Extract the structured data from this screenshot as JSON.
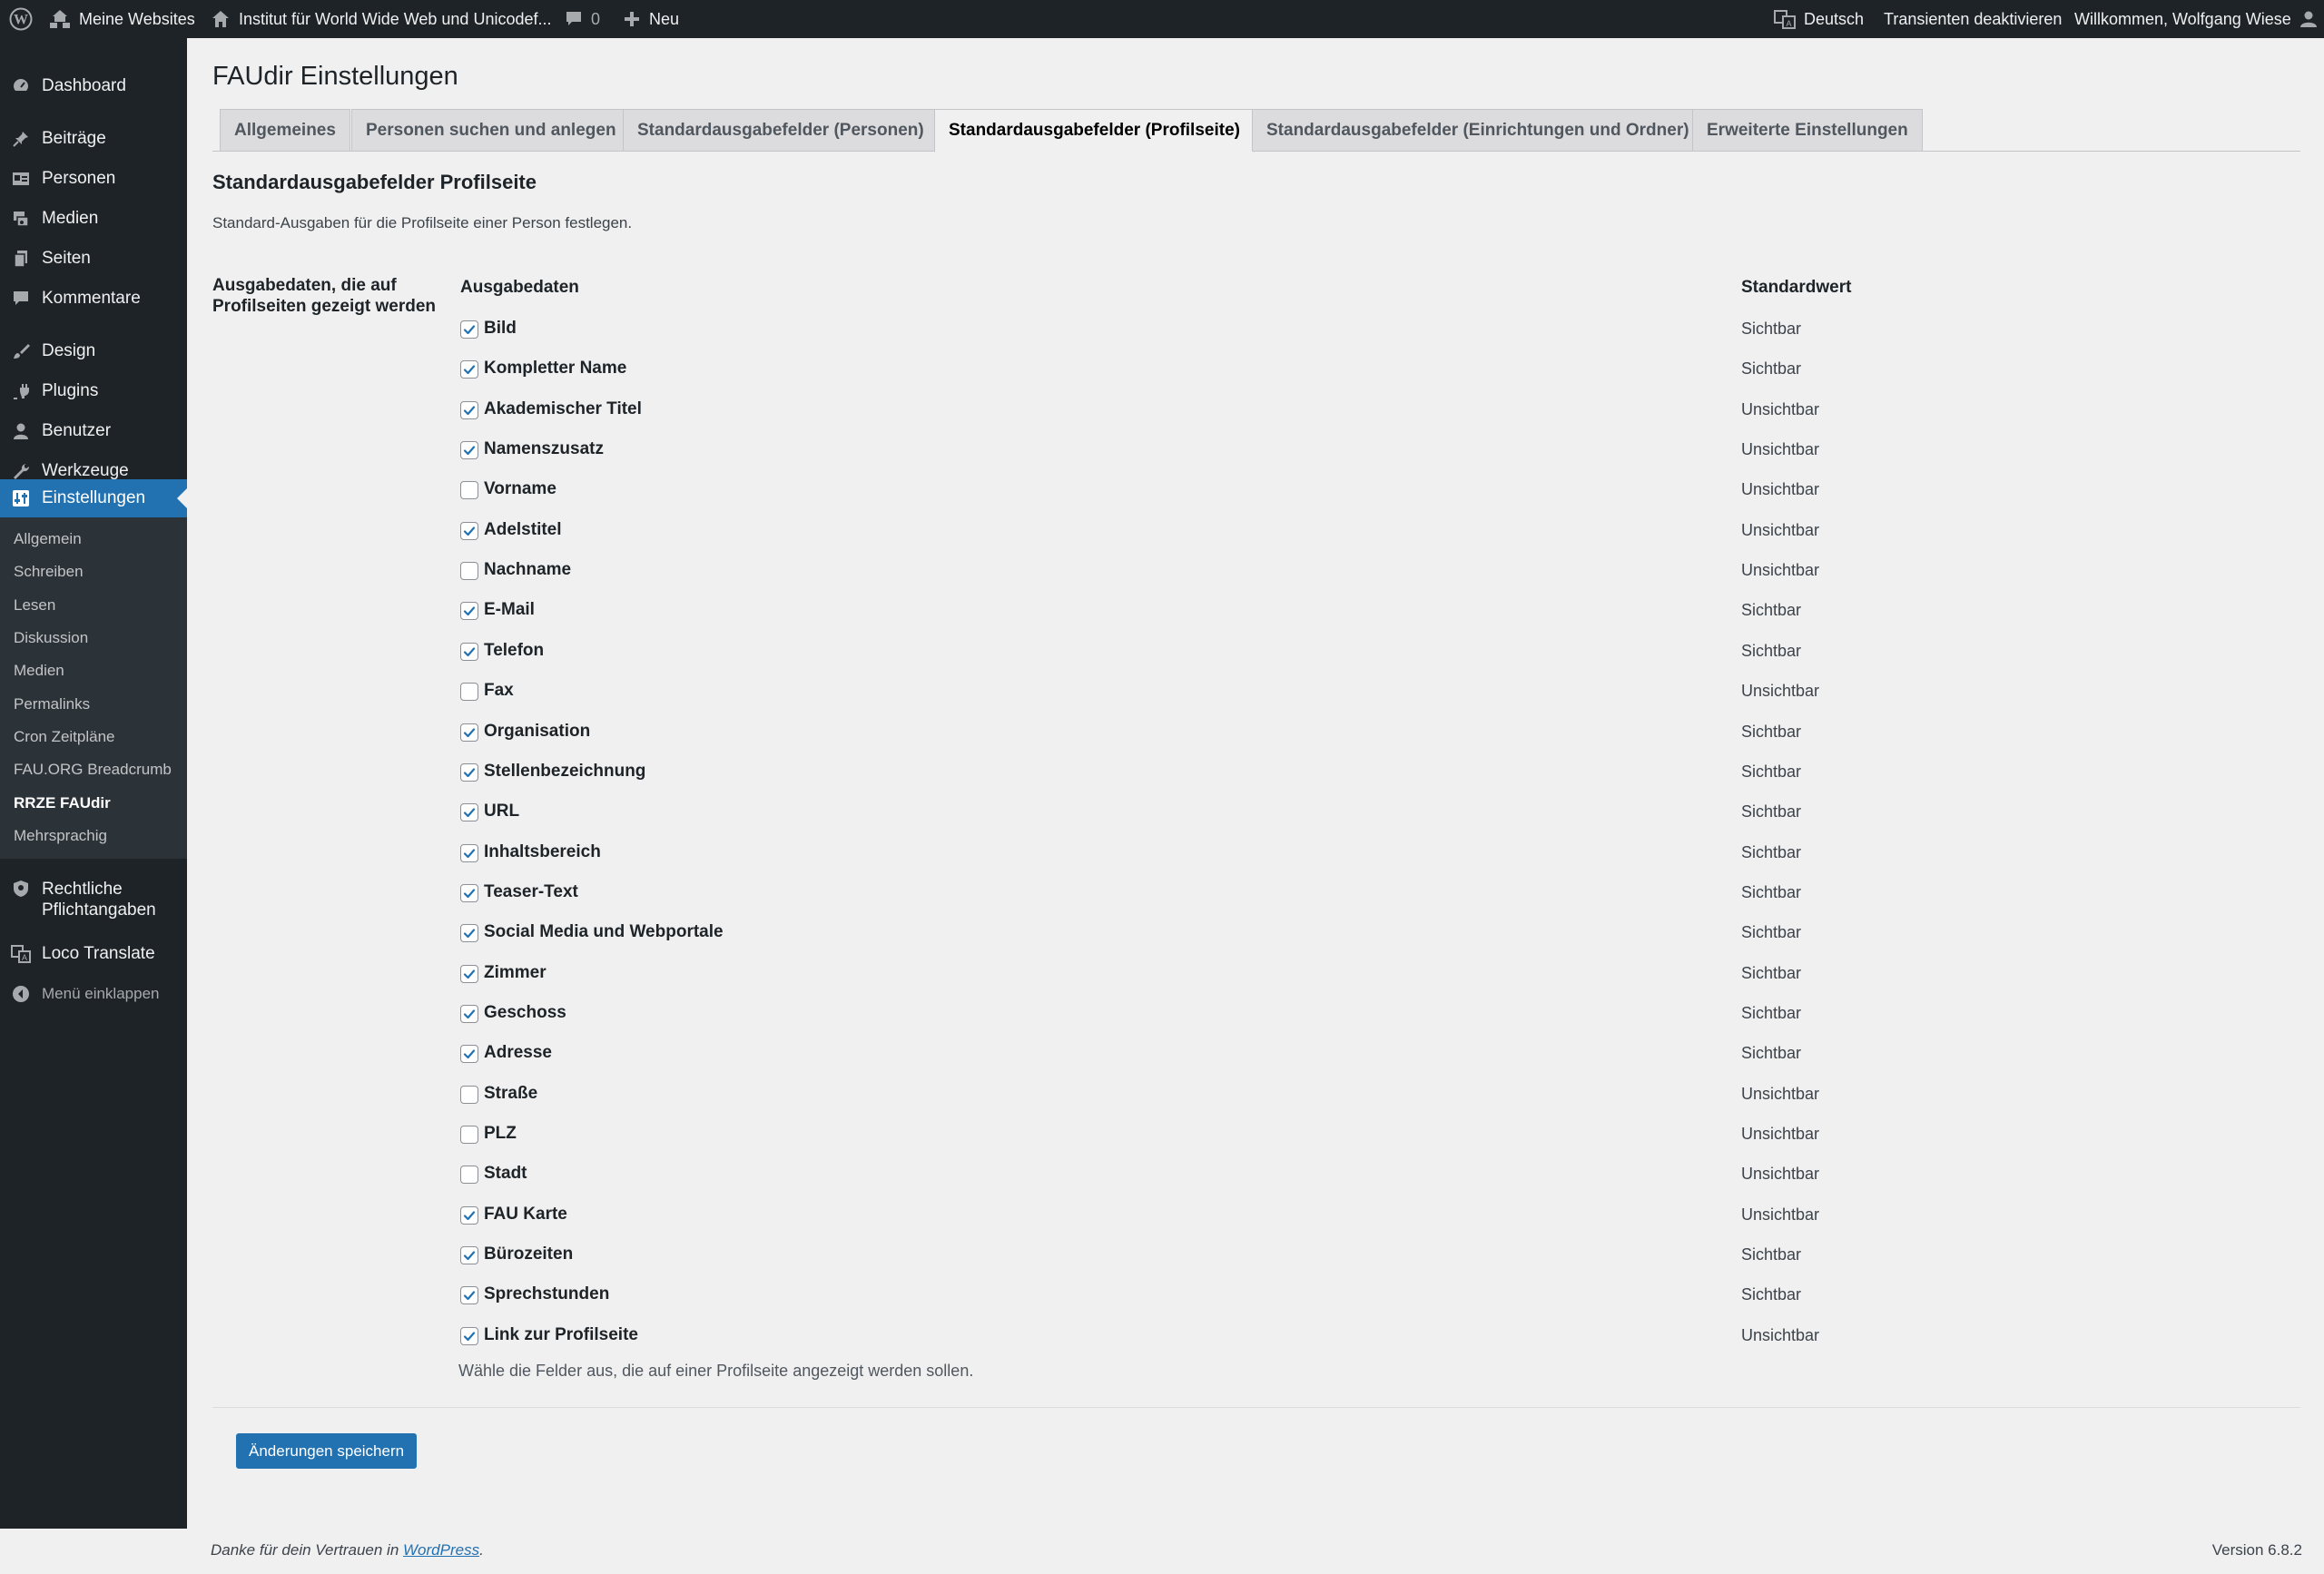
{
  "adminbar": {
    "my_sites": "Meine Websites",
    "site_name": "Institut für World Wide Web und Unicodef...",
    "comments_count": "0",
    "new_label": "Neu",
    "language": "Deutsch",
    "transients": "Transienten deaktivieren",
    "welcome": "Willkommen, Wolfgang Wiese"
  },
  "menu": {
    "dashboard": "Dashboard",
    "posts": "Beiträge",
    "persons": "Personen",
    "media": "Medien",
    "pages": "Seiten",
    "comments": "Kommentare",
    "design": "Design",
    "plugins": "Plugins",
    "users": "Benutzer",
    "tools": "Werkzeuge",
    "settings": "Einstellungen",
    "legal": "Rechtliche Pflichtangaben",
    "loco": "Loco Translate",
    "collapse": "Menü einklappen",
    "submenu": [
      "Allgemein",
      "Schreiben",
      "Lesen",
      "Diskussion",
      "Medien",
      "Permalinks",
      "Cron Zeitpläne",
      "FAU.ORG Breadcrumb",
      "RRZE FAUdir",
      "Mehrsprachig"
    ]
  },
  "page": {
    "title": "FAUdir Einstellungen",
    "tabs": [
      "Allgemeines",
      "Personen suchen und anlegen",
      "Standardausgabefelder (Personen)",
      "Standardausgabefelder (Profilseite)",
      "Standardausgabefelder (Einrichtungen und Ordner)",
      "Erweiterte Einstellungen"
    ],
    "section_title": "Standardausgabefelder Profilseite",
    "section_desc": "Standard-Ausgaben für die Profilseite einer Person festlegen.",
    "row_label": "Ausgabedaten, die auf Profilseiten gezeigt werden",
    "col_output": "Ausgabedaten",
    "col_default": "Standardwert",
    "help": "Wähle die Felder aus, die auf einer Profilseite angezeigt werden sollen.",
    "save": "Änderungen speichern"
  },
  "fields": [
    {
      "label": "Bild",
      "checked": true,
      "default": "Sichtbar"
    },
    {
      "label": "Kompletter Name",
      "checked": true,
      "default": "Sichtbar"
    },
    {
      "label": "Akademischer Titel",
      "checked": true,
      "default": "Unsichtbar"
    },
    {
      "label": "Namenszusatz",
      "checked": true,
      "default": "Unsichtbar"
    },
    {
      "label": "Vorname",
      "checked": false,
      "default": "Unsichtbar"
    },
    {
      "label": "Adelstitel",
      "checked": true,
      "default": "Unsichtbar"
    },
    {
      "label": "Nachname",
      "checked": false,
      "default": "Unsichtbar"
    },
    {
      "label": "E-Mail",
      "checked": true,
      "default": "Sichtbar"
    },
    {
      "label": "Telefon",
      "checked": true,
      "default": "Sichtbar"
    },
    {
      "label": "Fax",
      "checked": false,
      "default": "Unsichtbar"
    },
    {
      "label": "Organisation",
      "checked": true,
      "default": "Sichtbar"
    },
    {
      "label": "Stellenbezeichnung",
      "checked": true,
      "default": "Sichtbar"
    },
    {
      "label": "URL",
      "checked": true,
      "default": "Sichtbar"
    },
    {
      "label": "Inhaltsbereich",
      "checked": true,
      "default": "Sichtbar"
    },
    {
      "label": "Teaser-Text",
      "checked": true,
      "default": "Sichtbar"
    },
    {
      "label": "Social Media und Webportale",
      "checked": true,
      "default": "Sichtbar"
    },
    {
      "label": "Zimmer",
      "checked": true,
      "default": "Sichtbar"
    },
    {
      "label": "Geschoss",
      "checked": true,
      "default": "Sichtbar"
    },
    {
      "label": "Adresse",
      "checked": true,
      "default": "Sichtbar"
    },
    {
      "label": "Straße",
      "checked": false,
      "default": "Unsichtbar"
    },
    {
      "label": "PLZ",
      "checked": false,
      "default": "Unsichtbar"
    },
    {
      "label": "Stadt",
      "checked": false,
      "default": "Unsichtbar"
    },
    {
      "label": "FAU Karte",
      "checked": true,
      "default": "Unsichtbar"
    },
    {
      "label": "Bürozeiten",
      "checked": true,
      "default": "Sichtbar"
    },
    {
      "label": "Sprechstunden",
      "checked": true,
      "default": "Sichtbar"
    },
    {
      "label": "Link zur Profilseite",
      "checked": true,
      "default": "Unsichtbar"
    }
  ],
  "footer": {
    "thanks_prefix": "Danke für dein Vertrauen in ",
    "wordpress": "WordPress",
    "thanks_suffix": ".",
    "version": "Version 6.8.2"
  },
  "colors": {
    "accent": "#2271b1",
    "adminbar_bg": "#1d2327",
    "page_bg": "#f0f0f1"
  }
}
